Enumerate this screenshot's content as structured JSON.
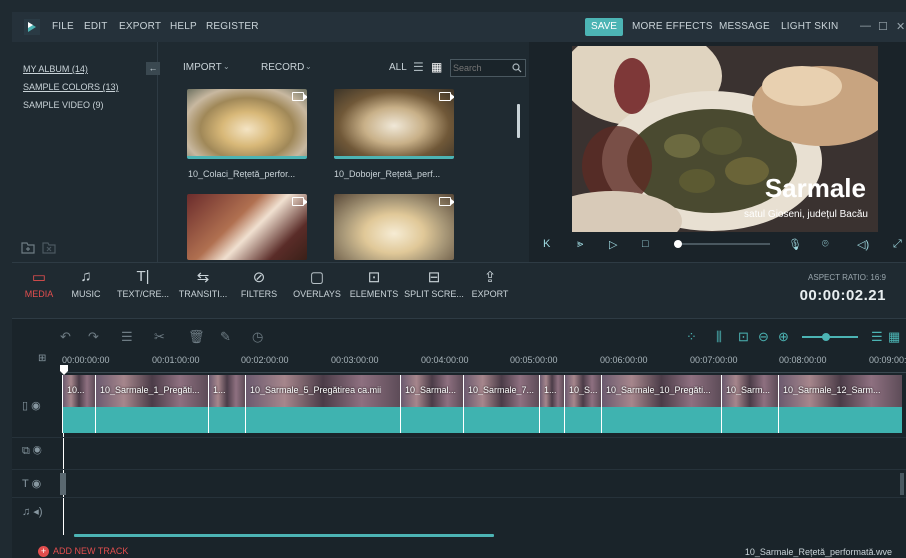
{
  "menu": {
    "file": "FILE",
    "edit": "EDIT",
    "export": "EXPORT",
    "help": "HELP",
    "register": "REGISTER",
    "save": "SAVE",
    "more_effects": "MORE EFFECTS",
    "message": "MESSAGE",
    "light_skin": "LIGHT SKIN"
  },
  "library": {
    "albums": [
      {
        "label": "MY ALBUM (14)"
      },
      {
        "label": "SAMPLE COLORS (13)"
      },
      {
        "label": "SAMPLE VIDEO (9)"
      }
    ],
    "import_label": "IMPORT",
    "record_label": "RECORD",
    "filter_label": "ALL",
    "search_placeholder": "Search",
    "media": [
      {
        "label": "10_Colaci_Rețetă_perfor..."
      },
      {
        "label": "10_Dobojer_Rețetă_perf..."
      },
      {
        "label": ""
      },
      {
        "label": ""
      }
    ]
  },
  "preview": {
    "title": "Sarmale",
    "subtitle": "satul Gioseni, județul Bacău"
  },
  "toolbar": {
    "media": "MEDIA",
    "music": "MUSIC",
    "text": "TEXT/CRE...",
    "transitions": "TRANSITI...",
    "filters": "FILTERS",
    "overlays": "OVERLAYS",
    "elements": "ELEMENTS",
    "split": "SPLIT SCRE...",
    "export": "EXPORT",
    "aspect_ratio": "ASPECT RATIO: 16:9",
    "timecode": "00:00:02.21"
  },
  "timeline": {
    "ruler": [
      "00:00:00:00",
      "00:01:00:00",
      "00:02:00:00",
      "00:03:00:00",
      "00:04:00:00",
      "00:05:00:00",
      "00:06:00:00",
      "00:07:00:00",
      "00:08:00:00",
      "00:09:00:00"
    ],
    "clips": [
      {
        "label": "10..."
      },
      {
        "label": "10_Sarmale_1_Pregăti..."
      },
      {
        "label": "1..."
      },
      {
        "label": "10_Sarmale_5_Pregătirea ca.mii"
      },
      {
        "label": "10_Sarmal..."
      },
      {
        "label": "10_Sarmale_7..."
      },
      {
        "label": "1..."
      },
      {
        "label": "10_S..."
      },
      {
        "label": "10_Sarmale_10_Pregăti..."
      },
      {
        "label": "10_Sarm..."
      },
      {
        "label": "10_Sarmale_12_Sarm..."
      }
    ],
    "add_track": "ADD NEW TRACK",
    "project_file": "10_Sarmale_Rețetă_performată.wve"
  },
  "colors": {
    "accent": "#4cb4b4",
    "active": "#e24e4e",
    "background": "#1f2a31"
  }
}
